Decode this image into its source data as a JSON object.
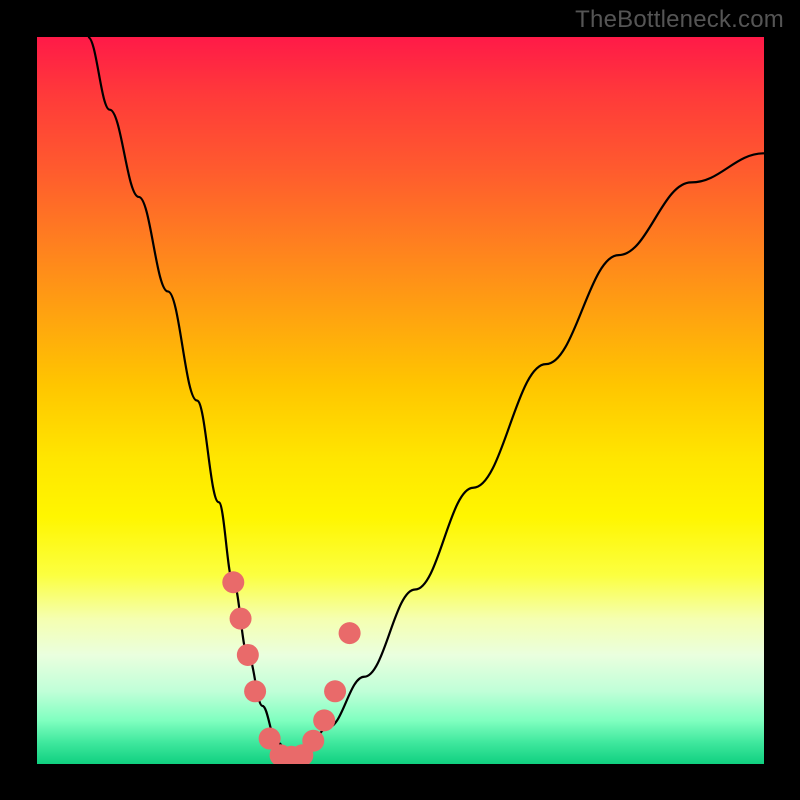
{
  "watermark": "TheBottleneck.com",
  "chart_data": {
    "type": "line",
    "title": "",
    "xlabel": "",
    "ylabel": "",
    "xlim": [
      0,
      100
    ],
    "ylim": [
      0,
      100
    ],
    "series": [
      {
        "name": "bottleneck-curve",
        "x": [
          7,
          10,
          14,
          18,
          22,
          25,
          27,
          29,
          31,
          33,
          35,
          37,
          40,
          45,
          52,
          60,
          70,
          80,
          90,
          100
        ],
        "values": [
          100,
          90,
          78,
          65,
          50,
          36,
          25,
          15,
          8,
          3,
          1,
          2,
          5,
          12,
          24,
          38,
          55,
          70,
          80,
          84
        ]
      }
    ],
    "markers": {
      "name": "highlighted-dots",
      "color": "#e96a6a",
      "points": [
        {
          "x": 27,
          "y": 25
        },
        {
          "x": 28,
          "y": 20
        },
        {
          "x": 29,
          "y": 15
        },
        {
          "x": 30,
          "y": 10
        },
        {
          "x": 32,
          "y": 3.5
        },
        {
          "x": 33.5,
          "y": 1.2
        },
        {
          "x": 35,
          "y": 1.0
        },
        {
          "x": 36.5,
          "y": 1.2
        },
        {
          "x": 38,
          "y": 3.2
        },
        {
          "x": 39.5,
          "y": 6
        },
        {
          "x": 41,
          "y": 10
        },
        {
          "x": 43,
          "y": 18
        }
      ]
    },
    "gradient_stops": [
      {
        "pos": 0.0,
        "color": "#ff1a48"
      },
      {
        "pos": 0.5,
        "color": "#ffd000"
      },
      {
        "pos": 0.8,
        "color": "#f8ff90"
      },
      {
        "pos": 1.0,
        "color": "#10d080"
      }
    ]
  }
}
